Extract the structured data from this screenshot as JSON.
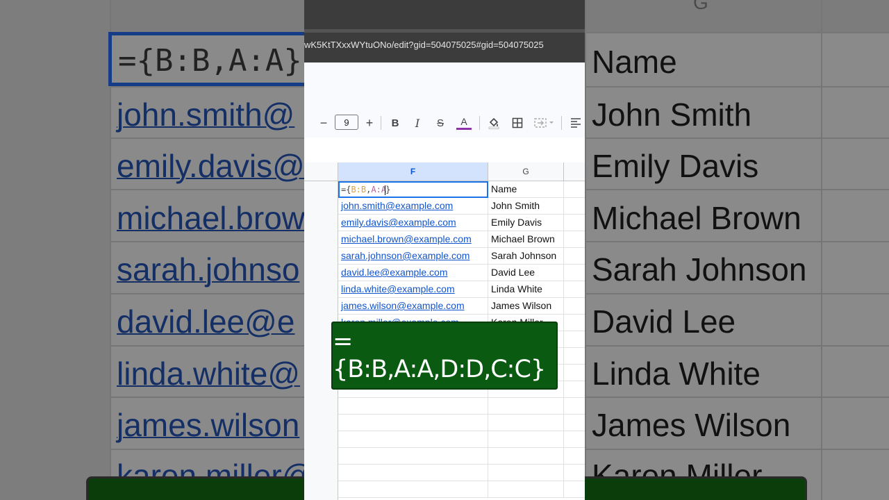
{
  "browser": {
    "url": "wK5KtTXxxWYtuONo/edit?gid=504075025#gid=504075025"
  },
  "toolbar": {
    "decrease_font_label": "−",
    "font_size": "9",
    "increase_font_label": "+",
    "bold_label": "B",
    "italic_label": "I",
    "strikethrough_label": "S",
    "text_color_label": "A",
    "text_color": "#8f32a8",
    "icons": [
      "minus-icon",
      "plus-icon",
      "bold-icon",
      "italic-icon",
      "strikethrough-icon",
      "text-color-icon",
      "fill-color-icon",
      "borders-icon",
      "merge-cells-icon",
      "align-left-icon"
    ]
  },
  "sheet": {
    "columns": [
      "F",
      "G"
    ],
    "selected_column": "F",
    "active_cell": {
      "brace_open": "={",
      "ref1": "B:B",
      "comma": ",",
      "ref2": "A:A",
      "brace_close": "}"
    },
    "header_g": "Name",
    "rows": [
      {
        "email": "john.smith@example.com",
        "name": "John Smith"
      },
      {
        "email": "emily.davis@example.com",
        "name": "Emily Davis"
      },
      {
        "email": "michael.brown@example.com",
        "name": "Michael Brown"
      },
      {
        "email": "sarah.johnson@example.com",
        "name": "Sarah Johnson"
      },
      {
        "email": "david.lee@example.com",
        "name": "David Lee"
      },
      {
        "email": "linda.white@example.com",
        "name": "Linda White"
      },
      {
        "email": "james.wilson@example.com",
        "name": "James Wilson"
      },
      {
        "email": "karen.miller@example.com",
        "name": "Karen Miller"
      }
    ]
  },
  "overlay": {
    "formula": "={B:B,A:A,D:D,C:C}",
    "color": "#0b5a12"
  },
  "background": {
    "column_letter": "G",
    "formula_fragment": "={B:B,A:A}",
    "emails": [
      "john.smith@",
      "emily.davis@",
      "michael.brow",
      "sarah.johnso",
      "david.lee@e",
      "linda.white@",
      "james.wilson",
      "karen miller@"
    ],
    "names": [
      "Name",
      "John Smith",
      "Emily Davis",
      "Michael Brown",
      "Sarah Johnson",
      "David Lee",
      "Linda White",
      "James Wilson",
      "Karen Miller"
    ]
  }
}
